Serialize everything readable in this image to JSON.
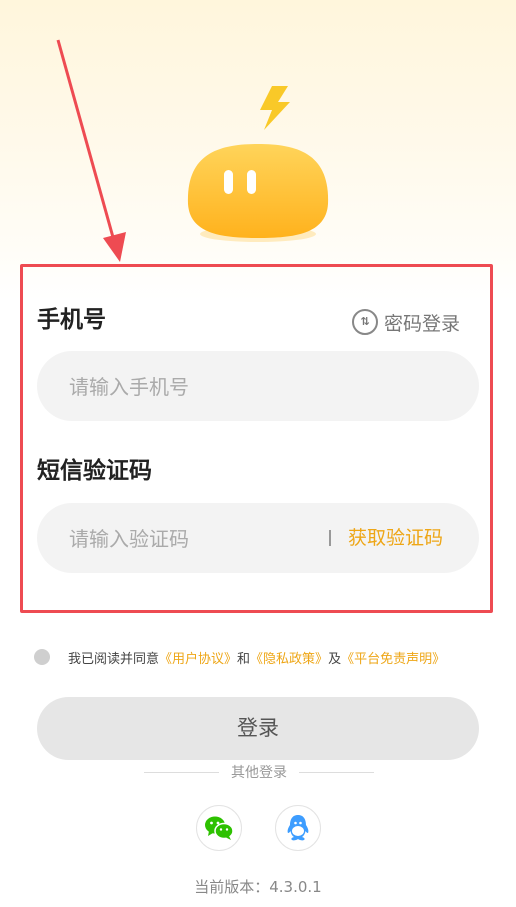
{
  "form": {
    "phone_title": "手机号",
    "password_login_label": "密码登录",
    "phone_placeholder": "请输入手机号",
    "sms_title": "短信验证码",
    "code_placeholder": "请输入验证码",
    "get_code_label": "获取验证码"
  },
  "agreement": {
    "prefix": "我已阅读并同意",
    "user_agreement": "《用户协议》",
    "and_text": "和",
    "privacy_policy": "《隐私政策》",
    "also_text": "及",
    "disclaimer": "《平台免责声明》"
  },
  "login_button_label": "登录",
  "other_login_label": "其他登录",
  "social_icons": [
    "wechat-icon",
    "qq-icon"
  ],
  "version_text": "当前版本：4.3.0.1",
  "colors": {
    "accent": "#eea616",
    "highlight": "#ee4b52",
    "input_bg": "#f3f3f3"
  }
}
